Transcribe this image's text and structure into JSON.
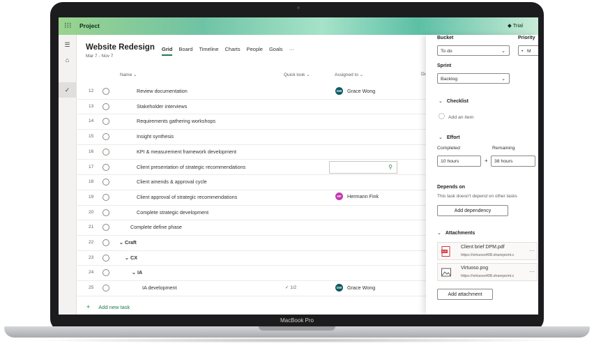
{
  "device": {
    "label": "MacBook Pro"
  },
  "topbar": {
    "app_name": "Project",
    "trial": "Trial"
  },
  "project": {
    "title": "Website Redesign",
    "dates": "Mar 7 - Nov 7",
    "tabs": [
      {
        "label": "Grid",
        "active": true
      },
      {
        "label": "Board"
      },
      {
        "label": "Timeline"
      },
      {
        "label": "Charts"
      },
      {
        "label": "People"
      },
      {
        "label": "Goals"
      },
      {
        "label": "···"
      }
    ]
  },
  "columns": {
    "name": "Name",
    "quick_look": "Quick look",
    "assigned_to": "Assigned to",
    "due": "Du"
  },
  "rows": [
    {
      "num": "12",
      "name": "Review documentation",
      "assignee": "Grace Wong",
      "initials": "GW",
      "avatar_color": "#0b5a63"
    },
    {
      "num": "13",
      "name": "Stakeholder interviews"
    },
    {
      "num": "14",
      "name": "Requirements gathering workshops"
    },
    {
      "num": "15",
      "name": "Insight synthesis"
    },
    {
      "num": "16",
      "name": "KPI & measurement framework development"
    },
    {
      "num": "17",
      "name": "Client presentation of strategic recommendations"
    },
    {
      "num": "18",
      "name": "Client amends & approval cycle"
    },
    {
      "num": "19",
      "name": "Client approval of strategic recommendations",
      "assignee": "Hermann Fink",
      "initials": "HF",
      "avatar_color": "#c239b3"
    },
    {
      "num": "20",
      "name": "Complete strategic development"
    },
    {
      "num": "21",
      "name": "Complete define phase"
    },
    {
      "num": "22",
      "name": "Craft"
    },
    {
      "num": "23",
      "name": "CX"
    },
    {
      "num": "24",
      "name": "IA"
    },
    {
      "num": "25",
      "name": "IA development",
      "quick_look": "1/2",
      "assignee": "Grace Wong",
      "initials": "GW",
      "avatar_color": "#0b5a63"
    }
  ],
  "add_task": "Add new task",
  "panel": {
    "bucket_label": "Bucket",
    "bucket_value": "To do",
    "priority_label": "Priority",
    "priority_value": "M",
    "sprint_label": "Sprint",
    "sprint_value": "Backlog",
    "checklist_label": "Checklist",
    "checklist_add": "Add an item",
    "effort_label": "Effort",
    "completed_label": "Completed",
    "completed_value": "10 hours",
    "remaining_label": "Remaining",
    "remaining_value": "38 hours",
    "plus": "+",
    "depends_label": "Depends on",
    "depends_text": "This task doesn't depend on other tasks",
    "add_dependency": "Add dependency",
    "attachments_label": "Attachments",
    "attachments": [
      {
        "name": "Client brief DPM.pdf",
        "url": "https://virtuoso408.sharepoint.c",
        "icon": "pdf-icon"
      },
      {
        "name": "Virtuoso.png",
        "url": "https://virtuoso408.sharepoint.c",
        "icon": "image-icon"
      }
    ],
    "add_attachment": "Add attachment"
  }
}
